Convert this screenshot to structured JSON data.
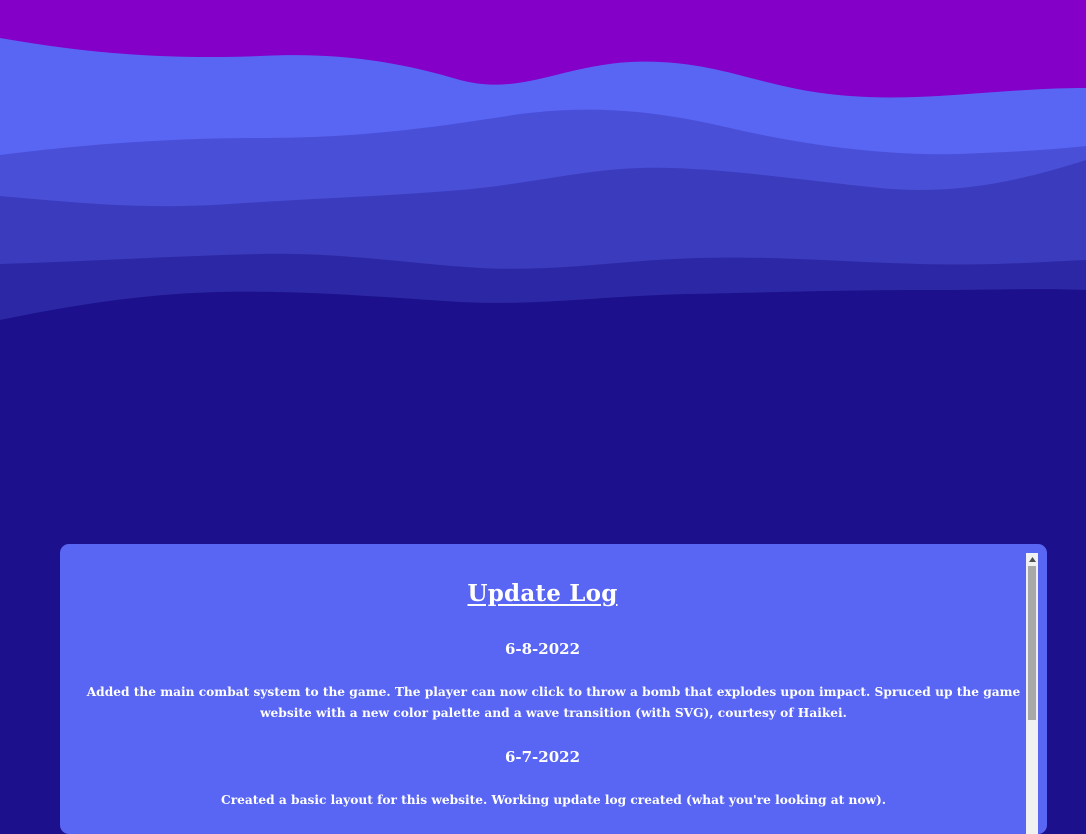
{
  "colors": {
    "page_background": "#1c108c",
    "panel_background": "#5966f3",
    "text": "#ffffff",
    "wave_layers": [
      "#8400c9",
      "#5966f3",
      "#4a4fd8",
      "#3b3bbd",
      "#2c27a4",
      "#1c108c"
    ]
  },
  "update_log": {
    "title": "Update Log",
    "entries": [
      {
        "date": "6-8-2022",
        "text": "Added the main combat system to the game. The player can now click to throw a bomb that explodes upon impact. Spruced up the game website with a new color palette and a wave transition (with SVG), courtesy of Haikei."
      },
      {
        "date": "6-7-2022",
        "text": "Created a basic layout for this website. Working update log created (what you're looking at now)."
      }
    ]
  },
  "scrollbar": {
    "up_icon": "triangle-up-icon"
  }
}
